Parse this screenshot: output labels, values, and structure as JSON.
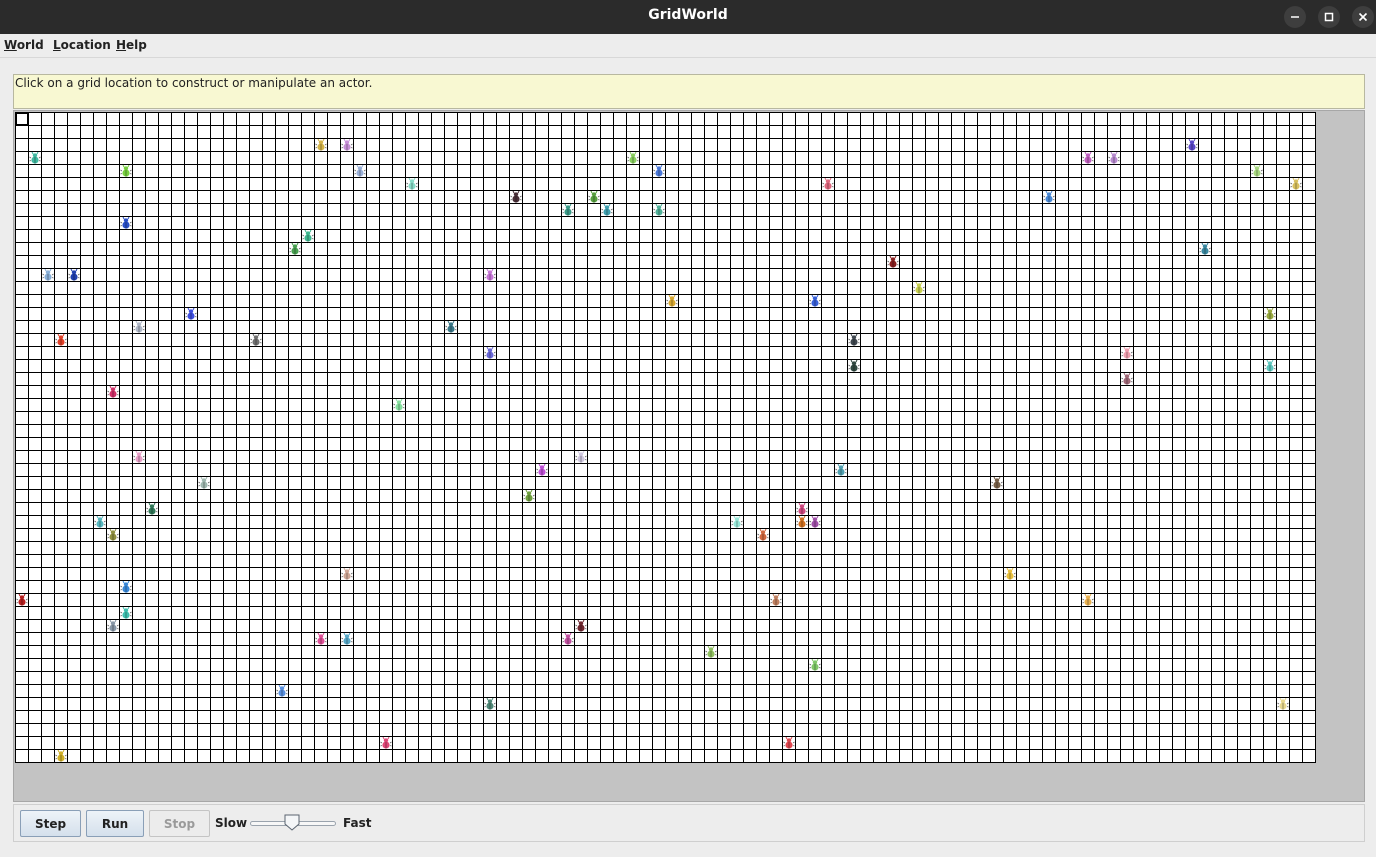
{
  "window": {
    "title": "GridWorld"
  },
  "menubar": {
    "items": [
      {
        "key": "W",
        "rest": "orld",
        "label": "World"
      },
      {
        "key": "L",
        "rest": "ocation",
        "label": "Location"
      },
      {
        "key": "H",
        "rest": "elp",
        "label": "Help"
      }
    ]
  },
  "message": "Click on a grid location to construct or manipulate an actor.",
  "grid": {
    "rows": 50,
    "cols": 100,
    "selected": [
      0,
      0
    ],
    "actor_icon": "bug-icon",
    "actors": [
      {
        "r": 2,
        "c": 23,
        "color": "#d4b44a"
      },
      {
        "r": 2,
        "c": 25,
        "color": "#c890d8"
      },
      {
        "r": 2,
        "c": 90,
        "color": "#5a48c8"
      },
      {
        "r": 3,
        "c": 1,
        "color": "#3fb8a0"
      },
      {
        "r": 3,
        "c": 47,
        "color": "#8ad060"
      },
      {
        "r": 3,
        "c": 82,
        "color": "#c060c0"
      },
      {
        "r": 3,
        "c": 84,
        "color": "#b88ad0"
      },
      {
        "r": 4,
        "c": 8,
        "color": "#78d040"
      },
      {
        "r": 4,
        "c": 26,
        "color": "#9ab0d8"
      },
      {
        "r": 4,
        "c": 49,
        "color": "#4a78d8"
      },
      {
        "r": 4,
        "c": 95,
        "color": "#a8d880"
      },
      {
        "r": 5,
        "c": 30,
        "color": "#88dcc8"
      },
      {
        "r": 5,
        "c": 62,
        "color": "#e06a80"
      },
      {
        "r": 5,
        "c": 98,
        "color": "#d8c060"
      },
      {
        "r": 6,
        "c": 38,
        "color": "#4a3038"
      },
      {
        "r": 6,
        "c": 44,
        "color": "#58a040"
      },
      {
        "r": 6,
        "c": 79,
        "color": "#4a8ad8"
      },
      {
        "r": 7,
        "c": 42,
        "color": "#3a9a88"
      },
      {
        "r": 7,
        "c": 45,
        "color": "#40a0b0"
      },
      {
        "r": 7,
        "c": 49,
        "color": "#50b098"
      },
      {
        "r": 8,
        "c": 8,
        "color": "#2a50c8"
      },
      {
        "r": 9,
        "c": 22,
        "color": "#40b890"
      },
      {
        "r": 10,
        "c": 21,
        "color": "#48a050"
      },
      {
        "r": 10,
        "c": 91,
        "color": "#3a88a0"
      },
      {
        "r": 11,
        "c": 67,
        "color": "#8a2020"
      },
      {
        "r": 12,
        "c": 2,
        "color": "#8ab0d8"
      },
      {
        "r": 12,
        "c": 4,
        "color": "#2040b0"
      },
      {
        "r": 12,
        "c": 36,
        "color": "#c878d8"
      },
      {
        "r": 13,
        "c": 69,
        "color": "#c8d050"
      },
      {
        "r": 14,
        "c": 50,
        "color": "#d8a830"
      },
      {
        "r": 14,
        "c": 61,
        "color": "#3860d8"
      },
      {
        "r": 15,
        "c": 13,
        "color": "#4050e0"
      },
      {
        "r": 15,
        "c": 96,
        "color": "#98a840"
      },
      {
        "r": 16,
        "c": 9,
        "color": "#b0b8c8"
      },
      {
        "r": 16,
        "c": 33,
        "color": "#3a7888"
      },
      {
        "r": 17,
        "c": 3,
        "color": "#e04028"
      },
      {
        "r": 17,
        "c": 18,
        "color": "#707070"
      },
      {
        "r": 17,
        "c": 64,
        "color": "#404850"
      },
      {
        "r": 18,
        "c": 36,
        "color": "#6a68d8"
      },
      {
        "r": 18,
        "c": 85,
        "color": "#f0a0b0"
      },
      {
        "r": 19,
        "c": 64,
        "color": "#304840"
      },
      {
        "r": 19,
        "c": 96,
        "color": "#60c8c0"
      },
      {
        "r": 20,
        "c": 85,
        "color": "#a06878"
      },
      {
        "r": 21,
        "c": 7,
        "color": "#d03068"
      },
      {
        "r": 22,
        "c": 29,
        "color": "#88e0a0"
      },
      {
        "r": 26,
        "c": 9,
        "color": "#e8a0c8"
      },
      {
        "r": 26,
        "c": 43,
        "color": "#d0c8e0"
      },
      {
        "r": 27,
        "c": 40,
        "color": "#c050d8"
      },
      {
        "r": 27,
        "c": 63,
        "color": "#50a0b0"
      },
      {
        "r": 28,
        "c": 14,
        "color": "#a0b8b0"
      },
      {
        "r": 28,
        "c": 75,
        "color": "#786048"
      },
      {
        "r": 29,
        "c": 39,
        "color": "#70a040"
      },
      {
        "r": 30,
        "c": 10,
        "color": "#307858"
      },
      {
        "r": 30,
        "c": 60,
        "color": "#d04880"
      },
      {
        "r": 31,
        "c": 6,
        "color": "#58b8c0"
      },
      {
        "r": 31,
        "c": 55,
        "color": "#98e8d8"
      },
      {
        "r": 31,
        "c": 60,
        "color": "#d07020"
      },
      {
        "r": 31,
        "c": 61,
        "color": "#a050a8"
      },
      {
        "r": 32,
        "c": 7,
        "color": "#909040"
      },
      {
        "r": 32,
        "c": 57,
        "color": "#d06840"
      },
      {
        "r": 35,
        "c": 25,
        "color": "#d0a898"
      },
      {
        "r": 35,
        "c": 76,
        "color": "#e8c040"
      },
      {
        "r": 36,
        "c": 8,
        "color": "#3888d8"
      },
      {
        "r": 37,
        "c": 0,
        "color": "#b82020"
      },
      {
        "r": 37,
        "c": 58,
        "color": "#c08060"
      },
      {
        "r": 37,
        "c": 82,
        "color": "#e8b050"
      },
      {
        "r": 38,
        "c": 8,
        "color": "#40c0b0"
      },
      {
        "r": 39,
        "c": 7,
        "color": "#8898a8"
      },
      {
        "r": 39,
        "c": 43,
        "color": "#702830"
      },
      {
        "r": 40,
        "c": 23,
        "color": "#e05098"
      },
      {
        "r": 40,
        "c": 25,
        "color": "#58a8c8"
      },
      {
        "r": 40,
        "c": 42,
        "color": "#c050a0"
      },
      {
        "r": 41,
        "c": 53,
        "color": "#90c060"
      },
      {
        "r": 42,
        "c": 61,
        "color": "#80c868"
      },
      {
        "r": 44,
        "c": 20,
        "color": "#5890e0"
      },
      {
        "r": 45,
        "c": 36,
        "color": "#508878"
      },
      {
        "r": 45,
        "c": 97,
        "color": "#e8d890"
      },
      {
        "r": 48,
        "c": 28,
        "color": "#e04878"
      },
      {
        "r": 48,
        "c": 59,
        "color": "#e04850"
      },
      {
        "r": 49,
        "c": 3,
        "color": "#d0b028"
      }
    ]
  },
  "controls": {
    "step_label": "Step",
    "run_label": "Run",
    "stop_label": "Stop",
    "slow_label": "Slow",
    "fast_label": "Fast",
    "speed_fraction": 0.48
  }
}
